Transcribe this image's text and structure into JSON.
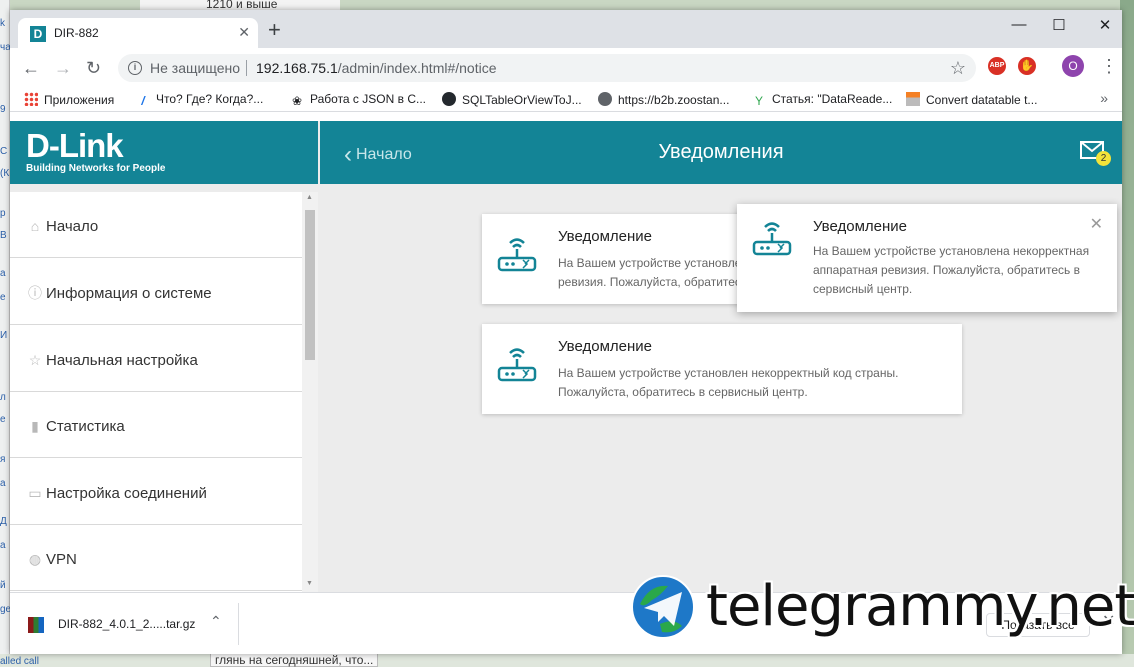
{
  "desktop": {
    "top_text": "1210 и выше",
    "bottom_text": "глянь на сегодняшней, что...",
    "left_fragments": [
      "k",
      "ча",
      "С",
      "(К",
      "9",
      "р",
      "В",
      "а",
      "е",
      "И",
      "л",
      "е",
      "я",
      "а",
      "Д",
      "а",
      "й",
      "ge",
      "alled call"
    ]
  },
  "browser": {
    "tab_title": "DIR-882",
    "tab_favicon": "D",
    "not_secure": "Не защищено",
    "url_host": "192.168.75.1",
    "url_path": "/admin/index.html#/notice",
    "profile_initial": "O",
    "ext_abp": "ABP",
    "bookmarks": [
      {
        "label": "Приложения",
        "icon": "apps-grid-icon"
      },
      {
        "label": "Что? Где? Когда?...",
        "icon": "owl-icon"
      },
      {
        "label": "Работа с JSON в С...",
        "icon": "paw-icon"
      },
      {
        "label": "SQLTableOrViewToJ...",
        "icon": "github-icon"
      },
      {
        "label": "https://b2b.zoostan...",
        "icon": "globe-icon"
      },
      {
        "label": "Статья: \"DataReade...",
        "icon": "leaf-icon"
      },
      {
        "label": "Convert datatable t...",
        "icon": "stack-icon"
      }
    ]
  },
  "router": {
    "logo": "D-Link",
    "logo_sub": "Building Networks for People",
    "back_label": "Начало",
    "page_title": "Уведомления",
    "notification_count": "2",
    "menu": [
      {
        "label": "Начало",
        "icon": "home-icon"
      },
      {
        "label": "Информация о системе",
        "icon": "info-icon"
      },
      {
        "label": "Начальная настройка",
        "icon": "star-icon"
      },
      {
        "label": "Статистика",
        "icon": "bar-chart-icon"
      },
      {
        "label": "Настройка соединений",
        "icon": "monitor-icon"
      },
      {
        "label": "VPN",
        "icon": "lock-icon"
      }
    ],
    "notifications": [
      {
        "title": "Уведомление",
        "text_line1": "На Вашем устройстве установлена некорректная аппаратная",
        "text_line2": "ревизия. Пожалуйста, обратитесь в сервисный центр."
      },
      {
        "title": "Уведомление",
        "text_line1": "На Вашем устройстве установлен некорректный код страны.",
        "text_line2": "Пожалуйста, обратитесь в сервисный центр."
      }
    ],
    "popup": {
      "title": "Уведомление",
      "text_line1": "На Вашем устройстве установлена некорректная",
      "text_line2": "аппаратная ревизия. Пожалуйста, обратитесь в",
      "text_line3": "сервисный центр."
    }
  },
  "downloads": {
    "file_name": "DIR-882_4.0.1_2.....tar.gz",
    "show_all": "Показать все"
  },
  "watermark": {
    "text": "telegrammy.net"
  },
  "colors": {
    "dlink_teal": "#138496",
    "badge_yellow": "#f3e33a"
  }
}
